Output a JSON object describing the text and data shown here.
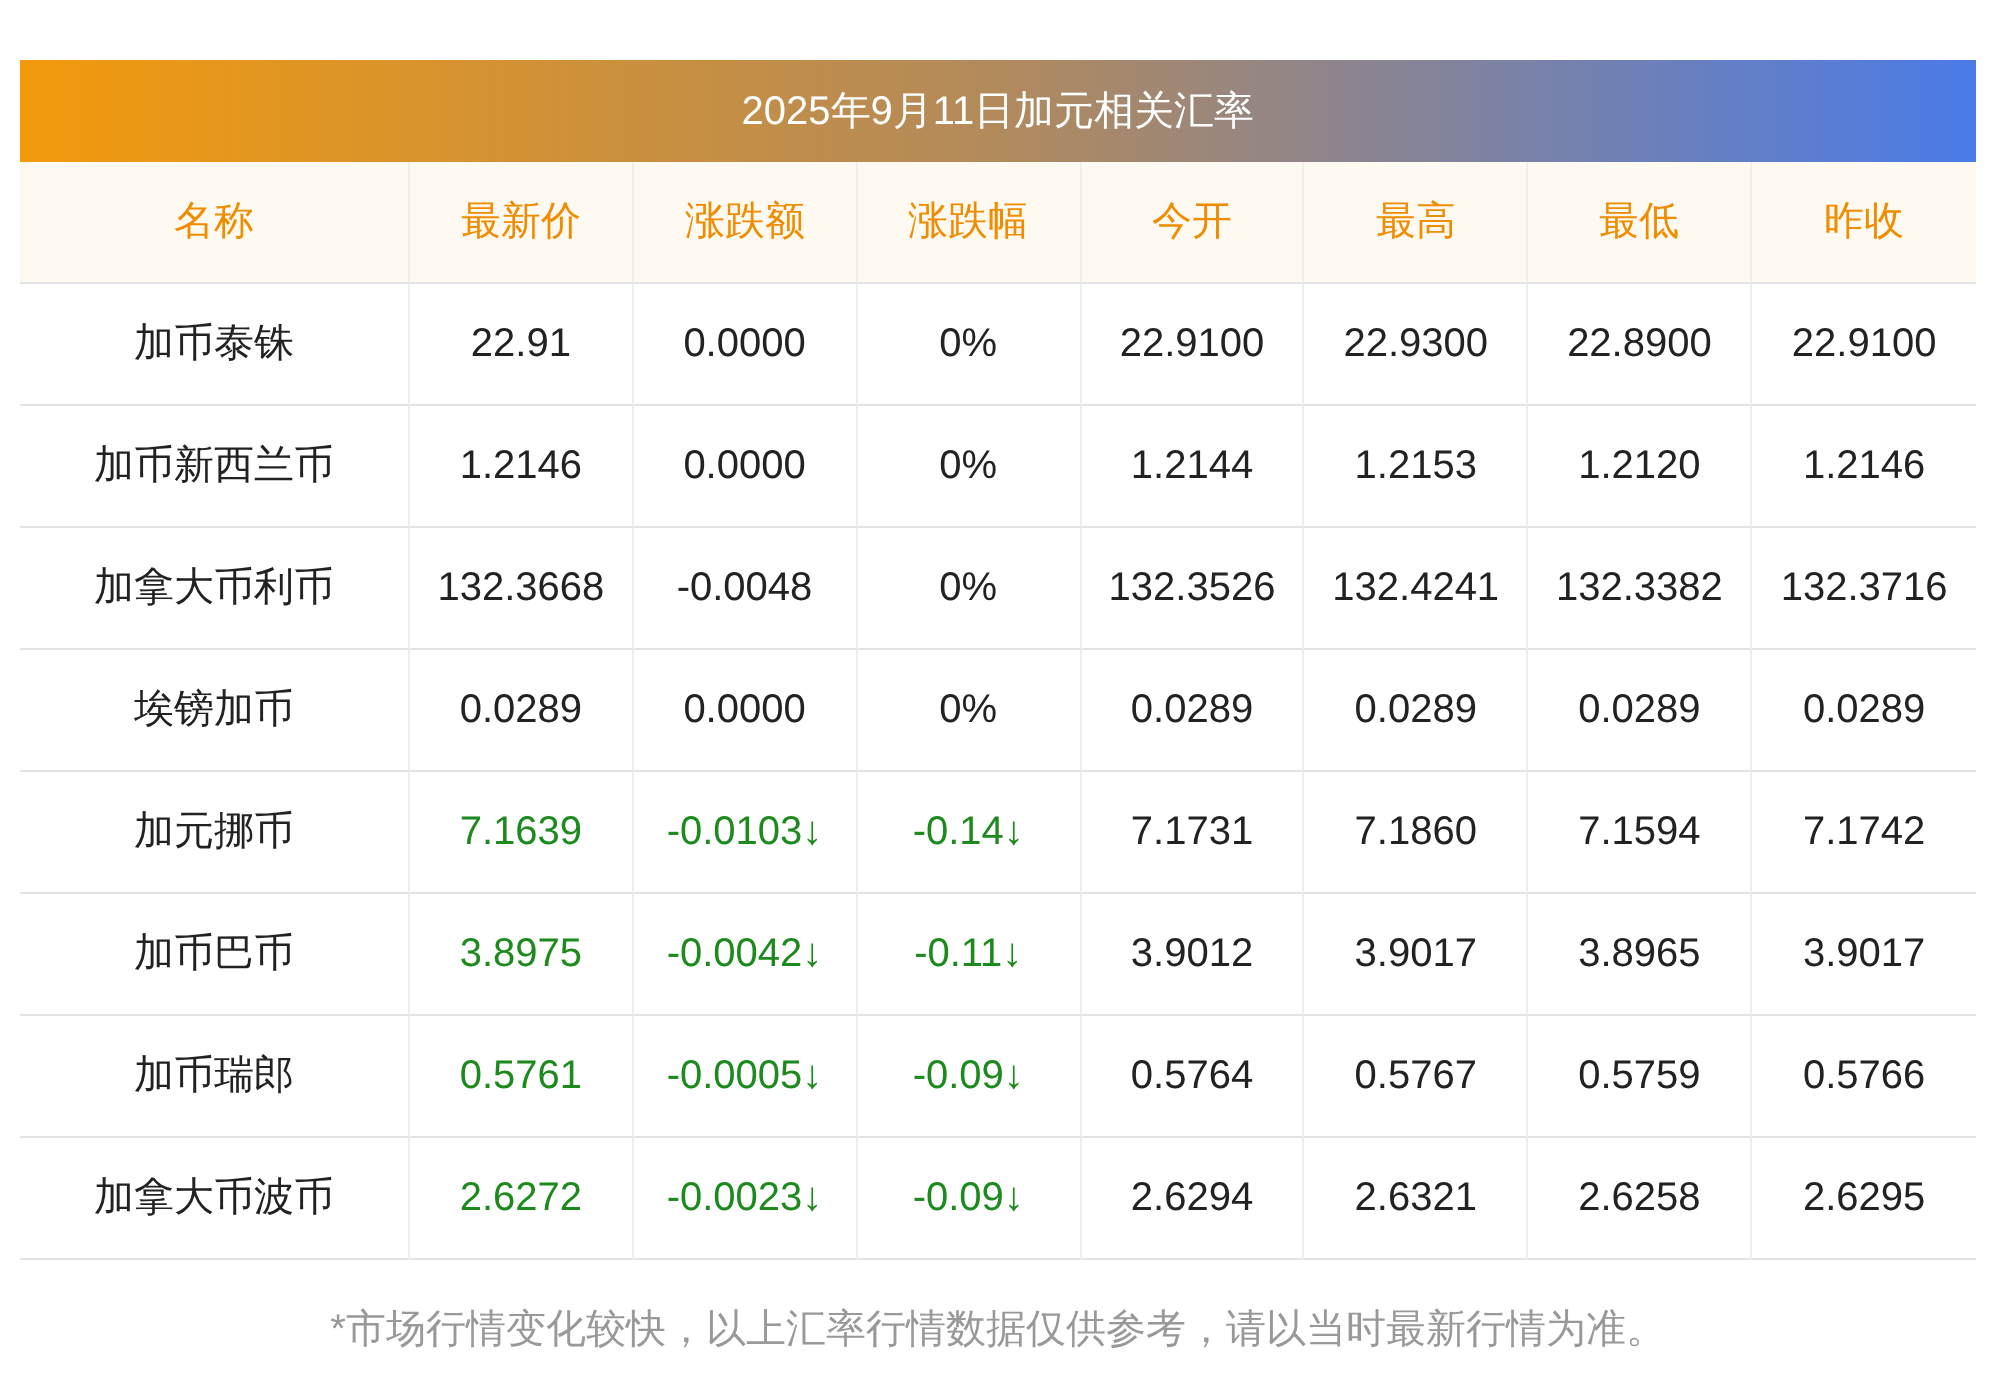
{
  "title": "2025年9月11日加元相关汇率",
  "columns": [
    "名称",
    "最新价",
    "涨跌额",
    "涨跌幅",
    "今开",
    "最高",
    "最低",
    "昨收"
  ],
  "rows": [
    {
      "falling": false,
      "cells": [
        "加币泰铢",
        "22.91",
        "0.0000",
        "0%",
        "22.9100",
        "22.9300",
        "22.8900",
        "22.9100"
      ]
    },
    {
      "falling": false,
      "cells": [
        "加币新西兰币",
        "1.2146",
        "0.0000",
        "0%",
        "1.2144",
        "1.2153",
        "1.2120",
        "1.2146"
      ]
    },
    {
      "falling": false,
      "cells": [
        "加拿大币利币",
        "132.3668",
        "-0.0048",
        "0%",
        "132.3526",
        "132.4241",
        "132.3382",
        "132.3716"
      ]
    },
    {
      "falling": false,
      "cells": [
        "埃镑加币",
        "0.0289",
        "0.0000",
        "0%",
        "0.0289",
        "0.0289",
        "0.0289",
        "0.0289"
      ]
    },
    {
      "falling": true,
      "cells": [
        "加元挪币",
        "7.1639",
        "-0.0103↓",
        "-0.14↓",
        "7.1731",
        "7.1860",
        "7.1594",
        "7.1742"
      ]
    },
    {
      "falling": true,
      "cells": [
        "加币巴币",
        "3.8975",
        "-0.0042↓",
        "-0.11↓",
        "3.9012",
        "3.9017",
        "3.8965",
        "3.9017"
      ]
    },
    {
      "falling": true,
      "cells": [
        "加币瑞郎",
        "0.5761",
        "-0.0005↓",
        "-0.09↓",
        "0.5764",
        "0.5767",
        "0.5759",
        "0.5766"
      ]
    },
    {
      "falling": true,
      "cells": [
        "加拿大币波币",
        "2.6272",
        "-0.0023↓",
        "-0.09↓",
        "2.6294",
        "2.6321",
        "2.6258",
        "2.6295"
      ]
    }
  ],
  "footnote": "*市场行情变化较快，以上汇率行情数据仅供参考，请以当时最新行情为准。"
}
